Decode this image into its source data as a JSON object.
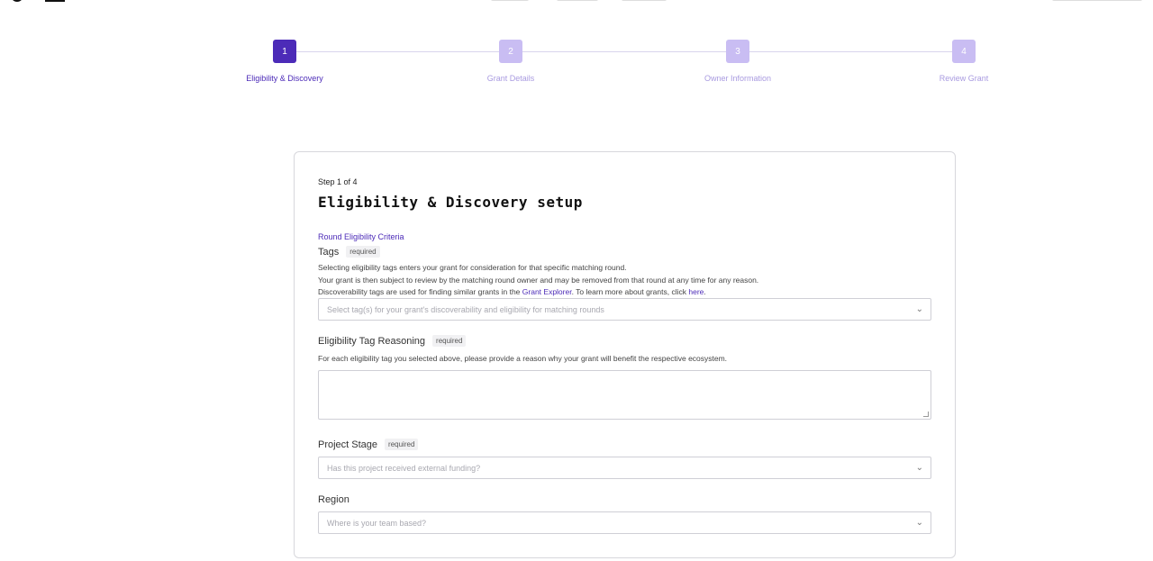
{
  "stepper": {
    "steps": [
      {
        "number": "1",
        "label": "Eligibility & Discovery"
      },
      {
        "number": "2",
        "label": "Grant Details"
      },
      {
        "number": "3",
        "label": "Owner Information"
      },
      {
        "number": "4",
        "label": "Review Grant"
      }
    ],
    "active_step": 1
  },
  "card": {
    "step_of": "Step 1 of 4",
    "title": "Eligibility & Discovery setup",
    "section_link": "Round Eligibility Criteria"
  },
  "tags": {
    "label": "Tags",
    "required": "required",
    "help_line_1": "Selecting eligibility tags enters your grant for consideration for that specific matching round.",
    "help_line_2": "Your grant is then subject to review by the matching round owner and may be removed from that round at any time for any reason.",
    "help_line_3_pre": "Discoverability tags are used for finding similar grants in the ",
    "help_line_3_link": "Grant Explorer",
    "help_line_3_mid": ". To learn more about grants, click ",
    "help_line_3_link2": "here",
    "help_line_3_end": ".",
    "placeholder": "Select tag(s) for your grant's discoverability and eligibility for matching rounds"
  },
  "reasoning": {
    "label": "Eligibility Tag Reasoning",
    "required": "required",
    "help": "For each eligibility tag you selected above, please provide a reason why your grant will benefit the respective ecosystem."
  },
  "stage": {
    "label": "Project Stage",
    "required": "required",
    "placeholder": "Has this project received external funding?"
  },
  "region": {
    "label": "Region",
    "placeholder": "Where is your team based?"
  },
  "icons": {
    "chevron": "chevron-down-icon"
  },
  "colors": {
    "accent": "#4c2bb8",
    "accent_light": "#c9bdf3"
  }
}
